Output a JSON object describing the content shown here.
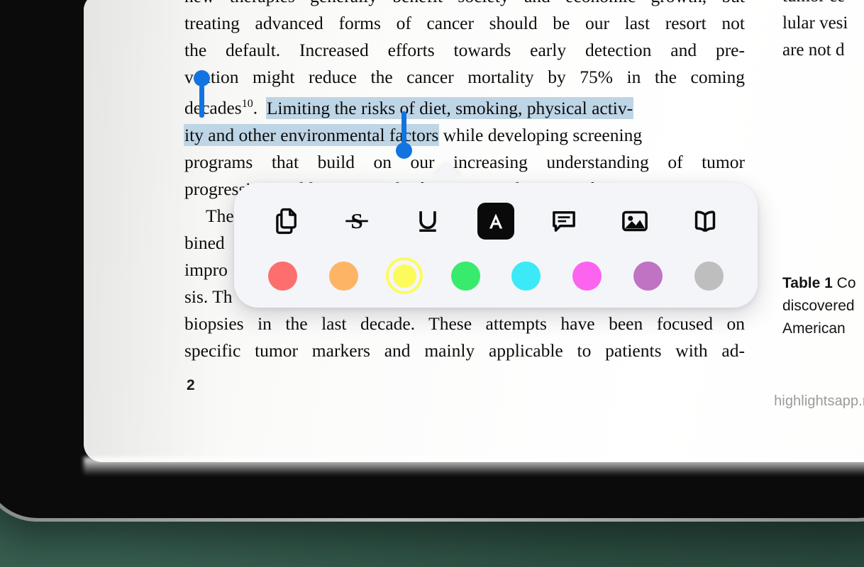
{
  "document": {
    "left_column_lines": [
      "new therapies generally benefit society and economic growth, but",
      "treating advanced forms of cancer should be our last resort not",
      "the default.  Increased efforts towards early detection and pre-",
      "vention might reduce the cancer mortality by 75% in the coming",
      "decades",
      "Limiting the risks of diet, smoking, physical activ-",
      "ity and other environmental factors",
      "while developing screening",
      "programs that build on our increasing understanding of tumor",
      "progression could minimize the future societal impact of cancer.",
      "The",
      "bined",
      "impro",
      "sis. Th",
      "biopsies in the last decade.  These attempts have been focused on",
      "specific tumor markers and mainly applicable to patients with ad-"
    ],
    "citation_superscript": "10",
    "selected_text": "Limiting the risks of diet, smoking, physical activity and other environmental factors",
    "right_column_lines": [
      "tumor ce",
      "lular vesi",
      "are not d"
    ],
    "table_caption": {
      "label": "Table 1",
      "line1_rest": " Co",
      "line2": "discovered",
      "line3": "American"
    },
    "page_number": "2",
    "watermark": "highlightsapp.net",
    "selection_color": "#bed5e6",
    "handle_color": "#1274e0"
  },
  "toolbar": {
    "tools": [
      {
        "name": "copy-icon",
        "label": "Copy",
        "active": false
      },
      {
        "name": "strikethrough-icon",
        "label": "Strikethrough",
        "active": false
      },
      {
        "name": "underline-icon",
        "label": "Underline",
        "active": false
      },
      {
        "name": "highlight-text-icon",
        "label": "Highlight Text",
        "active": true
      },
      {
        "name": "comment-icon",
        "label": "Comment",
        "active": false
      },
      {
        "name": "image-icon",
        "label": "Image",
        "active": false
      },
      {
        "name": "book-icon",
        "label": "Dictionary",
        "active": false
      }
    ],
    "colors": [
      {
        "name": "red",
        "hex": "#fd6e6e",
        "selected": false
      },
      {
        "name": "orange",
        "hex": "#fdb464",
        "selected": false
      },
      {
        "name": "yellow",
        "hex": "#fcfb5c",
        "selected": true
      },
      {
        "name": "green",
        "hex": "#38eb6c",
        "selected": false
      },
      {
        "name": "cyan",
        "hex": "#3ce9f7",
        "selected": false
      },
      {
        "name": "magenta",
        "hex": "#fc64f0",
        "selected": false
      },
      {
        "name": "purple",
        "hex": "#c072c3",
        "selected": false
      },
      {
        "name": "gray",
        "hex": "#bebebe",
        "selected": false
      }
    ],
    "background": "#f4f5f9",
    "active_button_background": "#0a0a0a"
  },
  "device": {
    "bezel_color": "#0b0b0b",
    "frame_color": "#9fa3a3",
    "backdrop_color": "#2f5245"
  }
}
